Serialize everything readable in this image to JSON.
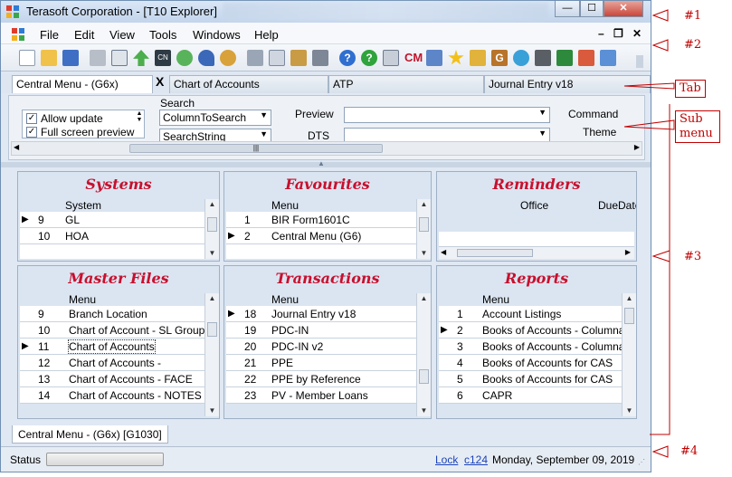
{
  "window": {
    "title": "Terasoft Corporation - [T10 Explorer]",
    "controls": {
      "minimize": "—",
      "maximize": "☐",
      "close": "✕"
    }
  },
  "menubar": {
    "items": [
      "File",
      "Edit",
      "View",
      "Tools",
      "Windows",
      "Help"
    ],
    "mdi_min": "–",
    "mdi_restore": "❐",
    "mdi_close": "✕"
  },
  "toolbar": {
    "icons": [
      "new-icon",
      "open-icon",
      "save-icon",
      "print-icon",
      "print-preview-icon",
      "up-arrow-icon",
      "cn-icon",
      "refresh-icon",
      "undo-icon",
      "search-icon",
      "cut-icon",
      "copy-icon",
      "paste-icon",
      "grid-icon",
      "help-icon",
      "help-green-icon",
      "calculator-icon",
      "cm-icon",
      "chart-icon",
      "star-icon",
      "edit-icon",
      "g-icon",
      "globe-icon",
      "stamp-icon",
      "excel-icon",
      "shapes-icon",
      "window-icon"
    ],
    "cm_text": "CM",
    "g_text": "G"
  },
  "tabs": [
    "Central Menu - (G6x)",
    "Chart of Accounts",
    "ATP",
    "Journal Entry v18"
  ],
  "tab_close": "X",
  "submenu": {
    "checks": [
      {
        "label": "Allow update",
        "checked": "✓"
      },
      {
        "label": "Full screen preview",
        "checked": "✓"
      }
    ],
    "search_label": "Search",
    "column_combo": "ColumnToSearch",
    "string_combo": "SearchString",
    "preview_label": "Preview",
    "dts_label": "DTS",
    "command_label": "Command",
    "theme_label": "Theme",
    "scroll_thumb": "|||"
  },
  "panels": [
    {
      "title": "Systems",
      "col": "System",
      "rows": [
        {
          "n": "9",
          "t": "GL",
          "ptr": true
        },
        {
          "n": "10",
          "t": "HOA",
          "ptr": false
        }
      ]
    },
    {
      "title": "Favourites",
      "col": "Menu",
      "rows": [
        {
          "n": "1",
          "t": "BIR Form1601C",
          "ptr": false
        },
        {
          "n": "2",
          "t": "Central Menu (G6)",
          "ptr": true
        }
      ]
    },
    {
      "title": "Reminders",
      "col": "Office",
      "col2": "DueDate",
      "rows": []
    },
    {
      "title": "Master Files",
      "col": "Menu",
      "rows": [
        {
          "n": "9",
          "t": "Branch Location",
          "ptr": false
        },
        {
          "n": "10",
          "t": "Chart of Account - SL Group",
          "ptr": false
        },
        {
          "n": "11",
          "t": "Chart of Accounts",
          "ptr": true
        },
        {
          "n": "12",
          "t": "Chart of Accounts -",
          "ptr": false
        },
        {
          "n": "13",
          "t": "Chart of Accounts - FACE",
          "ptr": false
        },
        {
          "n": "14",
          "t": "Chart of Accounts - NOTES",
          "ptr": false
        }
      ]
    },
    {
      "title": "Transactions",
      "col": "Menu",
      "rows": [
        {
          "n": "18",
          "t": "Journal Entry v18",
          "ptr": true
        },
        {
          "n": "19",
          "t": "PDC-IN",
          "ptr": false
        },
        {
          "n": "20",
          "t": "PDC-IN v2",
          "ptr": false
        },
        {
          "n": "21",
          "t": "PPE",
          "ptr": false
        },
        {
          "n": "22",
          "t": "PPE by Reference",
          "ptr": false
        },
        {
          "n": "23",
          "t": "PV - Member Loans",
          "ptr": false
        }
      ]
    },
    {
      "title": "Reports",
      "col": "Menu",
      "rows": [
        {
          "n": "1",
          "t": "Account Listings",
          "ptr": false
        },
        {
          "n": "2",
          "t": "Books of Accounts - Columnar",
          "ptr": true
        },
        {
          "n": "3",
          "t": "Books of Accounts - Columnar",
          "ptr": false
        },
        {
          "n": "4",
          "t": "Books of Accounts for CAS",
          "ptr": false
        },
        {
          "n": "5",
          "t": "Books of Accounts for CAS",
          "ptr": false
        },
        {
          "n": "6",
          "t": "CAPR",
          "ptr": false
        }
      ]
    }
  ],
  "bottom_tab": "Central Menu - (G6x) [G1030]",
  "status": {
    "label": "Status",
    "lock": "Lock",
    "user": "c124",
    "date": "Monday, September 09, 2019"
  },
  "annotations": {
    "a1": "#1",
    "a2": "#2",
    "tab": "Tab",
    "sub": "Sub\nmenu",
    "a3": "#3",
    "a4": "#4"
  },
  "colors": {
    "panel_title": "#c8102e",
    "annotation": "#c00000",
    "link": "#1a43b8"
  }
}
